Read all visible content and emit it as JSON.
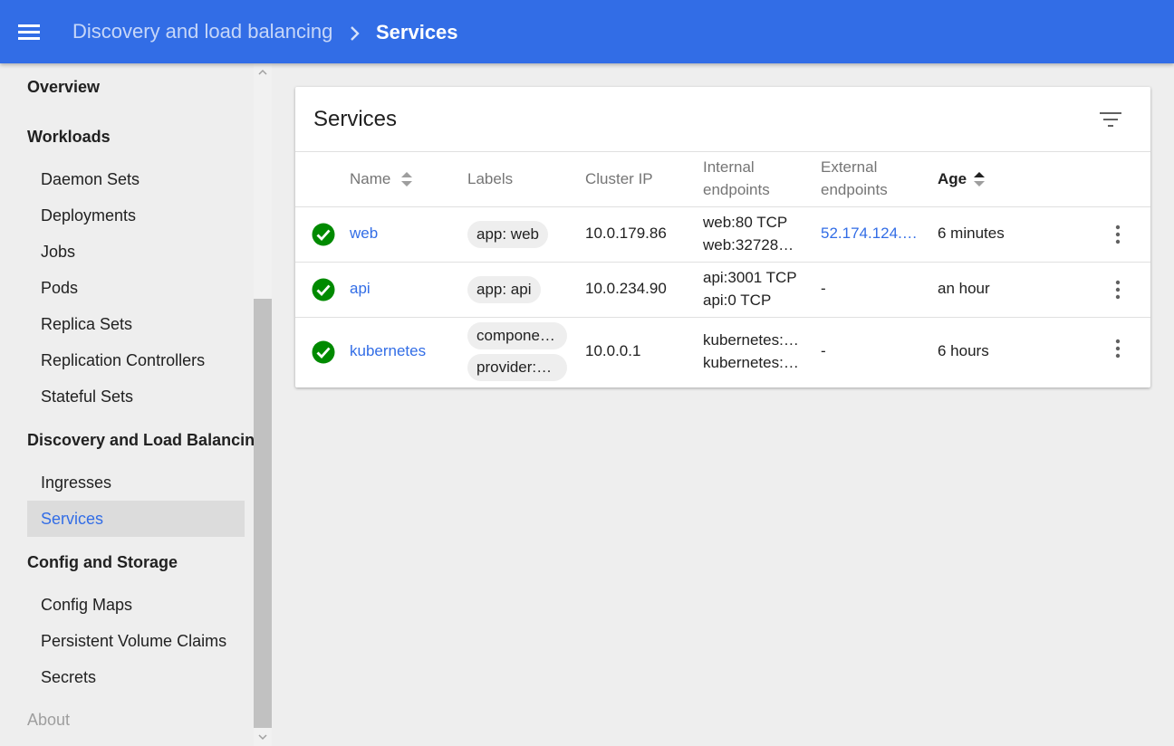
{
  "header": {
    "breadcrumb_parent": "Discovery and load balancing",
    "breadcrumb_current": "Services"
  },
  "sidebar": {
    "sections": [
      {
        "label": "Overview"
      },
      {
        "label": "Workloads",
        "items": [
          "Daemon Sets",
          "Deployments",
          "Jobs",
          "Pods",
          "Replica Sets",
          "Replication Controllers",
          "Stateful Sets"
        ]
      },
      {
        "label": "Discovery and Load Balancing",
        "items": [
          "Ingresses",
          "Services"
        ]
      },
      {
        "label": "Config and Storage",
        "items": [
          "Config Maps",
          "Persistent Volume Claims",
          "Secrets"
        ]
      },
      {
        "label": "About"
      }
    ],
    "active_item": "Services"
  },
  "card": {
    "title": "Services",
    "columns": {
      "name": "Name",
      "labels": "Labels",
      "cluster_ip": "Cluster IP",
      "internal_line1": "Internal",
      "internal_line2": "endpoints",
      "external_line1": "External",
      "external_line2": "endpoints",
      "age": "Age"
    },
    "rows": [
      {
        "name": "web",
        "labels": [
          "app: web"
        ],
        "cluster_ip": "10.0.179.86",
        "internal": [
          "web:80 TCP",
          "web:32728…"
        ],
        "external": "52.174.124.…",
        "age": "6 minutes"
      },
      {
        "name": "api",
        "labels": [
          "app: api"
        ],
        "cluster_ip": "10.0.234.90",
        "internal": [
          "api:3001 TCP",
          "api:0 TCP"
        ],
        "external": "-",
        "age": "an hour"
      },
      {
        "name": "kubernetes",
        "labels": [
          "compone…",
          "provider:…"
        ],
        "cluster_ip": "10.0.0.1",
        "internal": [
          "kubernetes:…",
          "kubernetes:…"
        ],
        "external": "-",
        "age": "6 hours"
      }
    ]
  },
  "colors": {
    "primary": "#326de6",
    "success": "#008a00",
    "background": "#eeeeee"
  },
  "icons": {
    "menu": "menu-icon",
    "chevron": "chevron-right-icon",
    "filter": "filter-icon",
    "status": "check-circle-icon",
    "sort": "sort-icon",
    "more": "more-vert-icon"
  }
}
